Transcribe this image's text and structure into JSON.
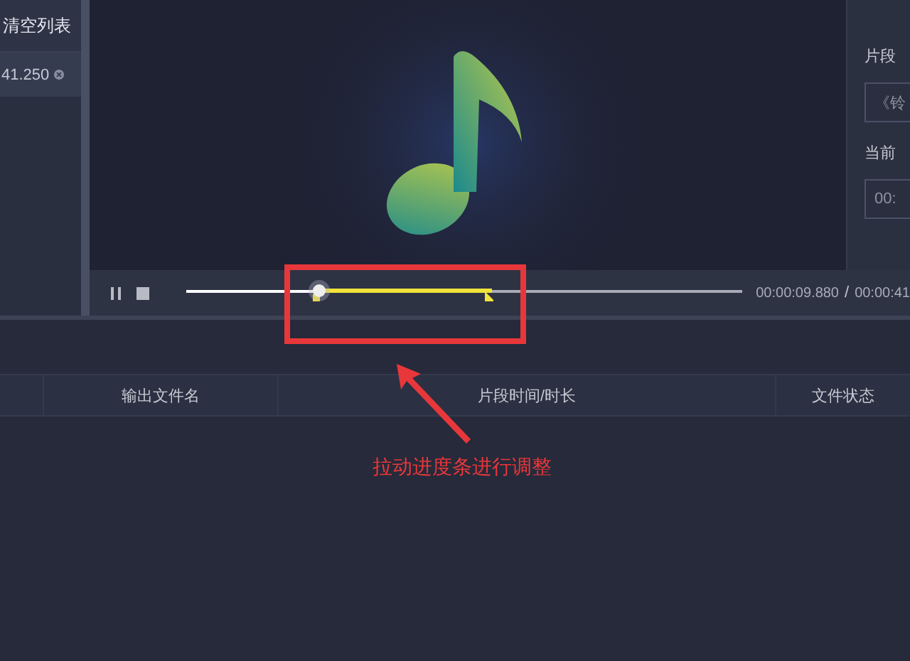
{
  "clip_list": {
    "clear_button": "清空列表",
    "items": [
      {
        "duration": "41.250",
        "selected": true
      }
    ]
  },
  "player": {
    "timeline": {
      "level": 0.24,
      "selection": {
        "start": {
          "level": 0.23
        },
        "end": {
          "level": 0.55
        }
      }
    },
    "current_time": "00:00:09.880",
    "separator": "/",
    "total_time": "00:00:41"
  },
  "segment_panel": {
    "name_label": "片段",
    "name_value": "《铃",
    "current_label": "当前",
    "current_value": "00:"
  },
  "table": {
    "columns": [
      "输出文件名",
      "片段时间/时长",
      "文件状态"
    ]
  },
  "annotation": {
    "text": "拉动进度条进行调整"
  }
}
